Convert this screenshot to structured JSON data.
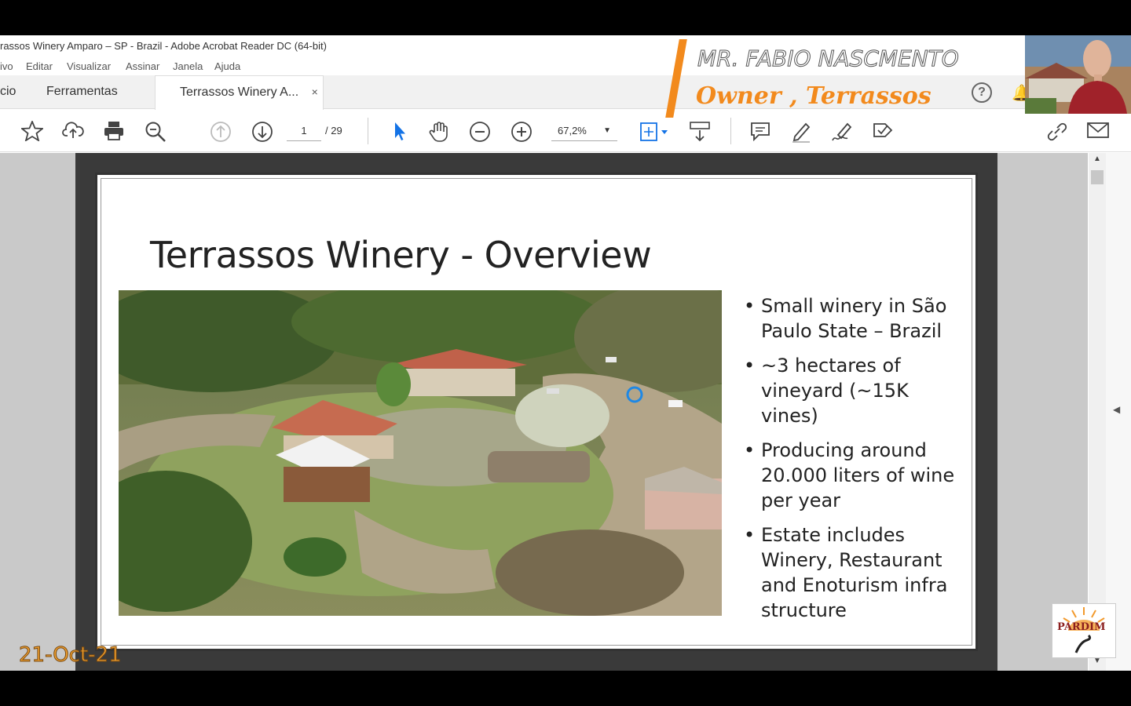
{
  "window": {
    "title": "rassos Winery Amparo – SP - Brazil - Adobe Acrobat Reader DC (64-bit)"
  },
  "menu": [
    "ivo",
    "Editar",
    "Visualizar",
    "Assinar",
    "Janela",
    "Ajuda"
  ],
  "tabs": {
    "home": "cio",
    "tools": "Ferramentas",
    "document": "Terrassos Winery A...",
    "close": "×"
  },
  "toolbar": {
    "page_current": "1",
    "page_total": "/  29",
    "zoom": "67,2%"
  },
  "slide": {
    "title": "Terrassos Winery - Overview",
    "bullets": [
      "Small winery in São Paulo State – Brazil",
      "~3 hectares of vineyard (~15K vines)",
      "Producing around 20.000 liters of wine per year",
      "Estate includes Winery, Restaurant and Enoturism infra structure"
    ]
  },
  "overlay": {
    "speaker_name": "MR. FABIO NASCMENTO",
    "speaker_role": "Owner , Terrassos",
    "date": "21-Oct-21",
    "logo_text": "PARDIM"
  },
  "colors": {
    "accent_orange": "#f28a1d",
    "selection_blue": "#1473e6"
  }
}
